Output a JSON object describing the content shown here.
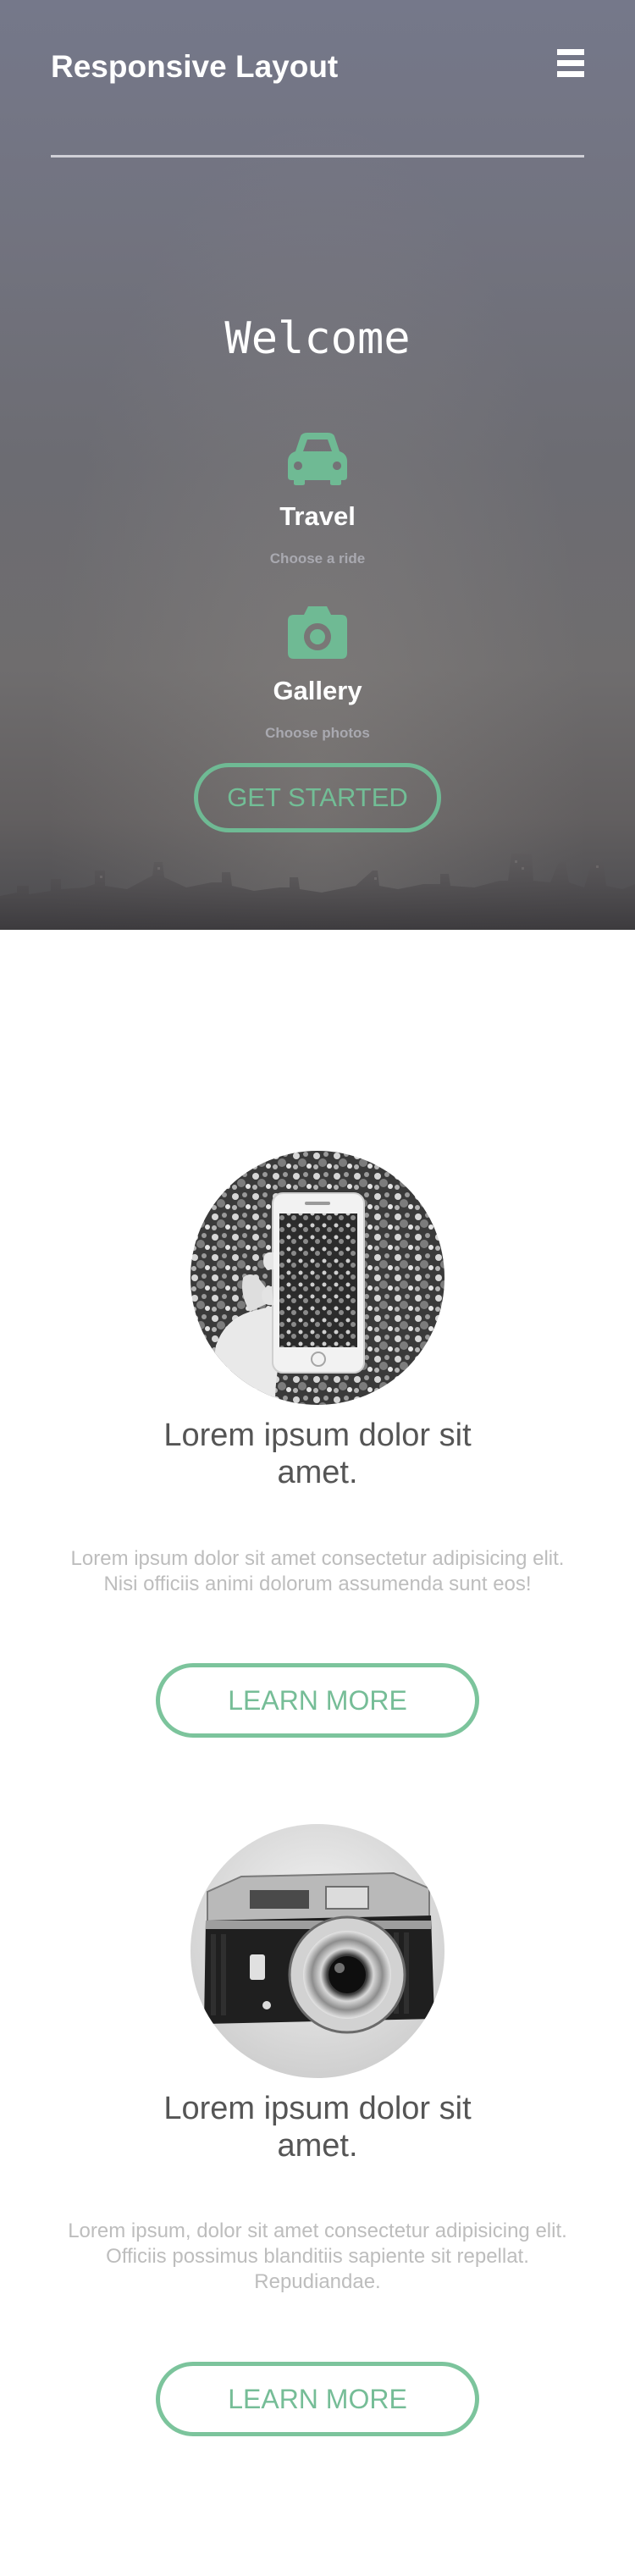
{
  "header": {
    "brand": "Responsive Layout",
    "menu_icon": "hamburger-menu-icon"
  },
  "hero": {
    "heading": "Welcome",
    "features": [
      {
        "icon": "car-icon",
        "title": "Travel",
        "subtitle": "Choose a ride"
      },
      {
        "icon": "camera-icon",
        "title": "Gallery",
        "subtitle": "Choose photos"
      }
    ],
    "cta_label": "GET STARTED"
  },
  "cards": [
    {
      "image": "phone-photo",
      "title": "Lorem ipsum dolor sit amet.",
      "text": "Lorem ipsum dolor sit amet consectetur adipisicing elit. Nisi officiis animi dolorum assumenda sunt eos!",
      "button": "LEARN MORE"
    },
    {
      "image": "vintage-camera-photo",
      "title": "Lorem ipsum dolor sit amet.",
      "text": "Lorem ipsum, dolor sit amet consectetur adipisicing elit. Officiis possimus blanditiis sapiente sit repellat. Repudiandae.",
      "button": "LEARN MORE"
    }
  ],
  "colors": {
    "accent": "#6fba94",
    "hero_overlay": "#72737f",
    "body_text": "#555555",
    "muted_text": "#bdbdbd",
    "hero_subtext": "#a9a9b0"
  }
}
